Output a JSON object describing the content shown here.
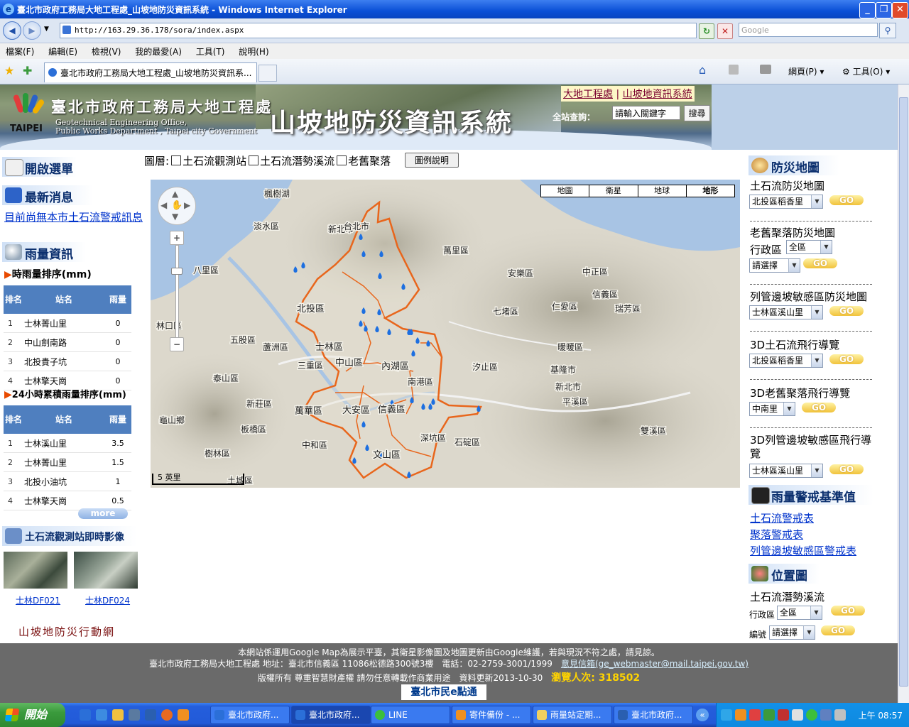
{
  "window": {
    "title": "臺北市政府工務局大地工程處_山坡地防災資訊系統 - Windows Internet Explorer",
    "minimize": "_",
    "maximize": "❐",
    "close": "✕"
  },
  "browser": {
    "url": "http://163.29.36.178/sora/index.aspx",
    "search_placeholder": "Google",
    "menu": [
      "檔案(F)",
      "編輯(E)",
      "檢視(V)",
      "我的最愛(A)",
      "工具(T)",
      "說明(H)"
    ],
    "tab_label": "臺北市政府工務局大地工程處_山坡地防災資訊系...",
    "commands": {
      "page": "網頁(P)",
      "tools": "工具(O)"
    }
  },
  "header": {
    "logo_text": "TAIPEI",
    "dept_zh": "臺北市政府工務局大地工程處",
    "dept_en_1": "Geotechnical Engineering Office,",
    "dept_en_2": "Public Works Department , Taipei city Government",
    "system_title": "山坡地防災資訊系統",
    "site_links": [
      "大地工程處",
      "山坡地資訊系統"
    ],
    "site_links_sep": "|",
    "search_label": "全站查詢：",
    "search_value": "請輸入關鍵字",
    "search_button": "搜尋"
  },
  "left": {
    "menu_title": "開啟選單",
    "news_title": "最新消息",
    "news_text": "目前尚無本市土石流警戒訊息",
    "rain_title": "雨量資訊",
    "hourly_title": "時雨量排序(mm)",
    "daily_title": "24小時累積雨量排序(mm)",
    "table_headers": {
      "rank": "排名",
      "station": "站名",
      "rain": "雨量"
    },
    "hourly_rows": [
      {
        "rank": "1",
        "station": "士林菁山里",
        "value": "0"
      },
      {
        "rank": "2",
        "station": "中山劍南路",
        "value": "0"
      },
      {
        "rank": "3",
        "station": "北投貴子坑",
        "value": "0"
      },
      {
        "rank": "4",
        "station": "士林擎天崗",
        "value": "0"
      }
    ],
    "daily_rows": [
      {
        "rank": "1",
        "station": "士林溪山里",
        "value": "3.5"
      },
      {
        "rank": "2",
        "station": "士林菁山里",
        "value": "1.5"
      },
      {
        "rank": "3",
        "station": "北投小油坑",
        "value": "1"
      },
      {
        "rank": "4",
        "station": "士林擎天崗",
        "value": "0.5"
      }
    ],
    "more_label": "more",
    "cam_title": "土石流觀測站即時影像",
    "cams": [
      "士林DF021",
      "士林DF024"
    ],
    "slogan": "山坡地防災行動網"
  },
  "map": {
    "layers_label": "圖層:",
    "layers": [
      "土石流觀測站",
      "土石流潛勢溪流",
      "老舊聚落"
    ],
    "legend_button": "圖例說明",
    "map_types": [
      "地圖",
      "衛星",
      "地球",
      "地形"
    ],
    "scale_label": "5 英里",
    "places": [
      "楓樹湖",
      "淡水區",
      "新北市",
      "台北市",
      "萬里區",
      "八里區",
      "安樂區",
      "中正區",
      "北投區",
      "七堵區",
      "仁愛區",
      "信義區",
      "瑞芳區",
      "林口區",
      "士林區",
      "五股區",
      "蘆洲區",
      "暖暖區",
      "中山區",
      "內湖區",
      "汐止區",
      "三重區",
      "泰山區",
      "南港區",
      "基隆市",
      "新北市",
      "新莊區",
      "大安區",
      "信義區",
      "平溪區",
      "萬華區",
      "龜山鄉",
      "板橋區",
      "深坑區",
      "石碇區",
      "雙溪區",
      "中和區",
      "文山區",
      "樹林區",
      "土城區"
    ]
  },
  "right": {
    "map_title": "防災地圖",
    "debris_map_label": "土石流防災地圖",
    "debris_map_select": "北投區稻香里",
    "old_settle_label": "老舊聚落防災地圖",
    "district_label": "行政區",
    "district_select": "全區",
    "choose_select": "請選擇",
    "slope_label": "列管邊坡敏感區防災地圖",
    "slope_select": "士林區溪山里",
    "fly3d_debris_label": "3D土石流飛行導覽",
    "fly3d_debris_select": "北投區稻香里",
    "fly3d_old_label": "3D老舊聚落飛行導覽",
    "fly3d_old_select": "中南里",
    "fly3d_slope_label": "3D列管邊坡敏感區飛行導覽",
    "fly3d_slope_select": "士林區溪山里",
    "go_label": "GO",
    "alert_title": "雨量警戒基準值",
    "alert_links": [
      "土石流警戒表",
      "聚落警戒表",
      "列管邊坡敏感區警戒表"
    ],
    "pos_title": "位置圖",
    "pos_label": "土石流潛勢溪流",
    "pos_district_label": "行政區",
    "pos_district_select": "全區",
    "pos_id_label": "編號",
    "pos_id_select": "請選擇"
  },
  "footer": {
    "line1": "本網站係運用Google Map為展示平臺，其衛星影像圖及地圖更新由Google維護，若與現況不符之處，請見諒。",
    "line2": "臺北市政府工務局大地工程處 地址：臺北市信義區 11086松德路300號3樓　電話：02-2759-3001/1999",
    "mail_label": "意見信箱",
    "mail": "(ge_webmaster@mail.taipei.gov.tw)",
    "line3": "版權所有 尊重智慧財產權 請勿任意轉載作商業用途　資料更新2013-10-30",
    "visits": "瀏覽人次: 318502",
    "city_logo": "臺北市民e點通"
  },
  "taskbar": {
    "start": "開始",
    "tasks": [
      "臺北市政府...",
      "臺北市政府...",
      "LINE",
      "寄件備份 - ...",
      "雨量站定期...",
      "臺北市政府..."
    ],
    "clock": "上午 08:57"
  }
}
